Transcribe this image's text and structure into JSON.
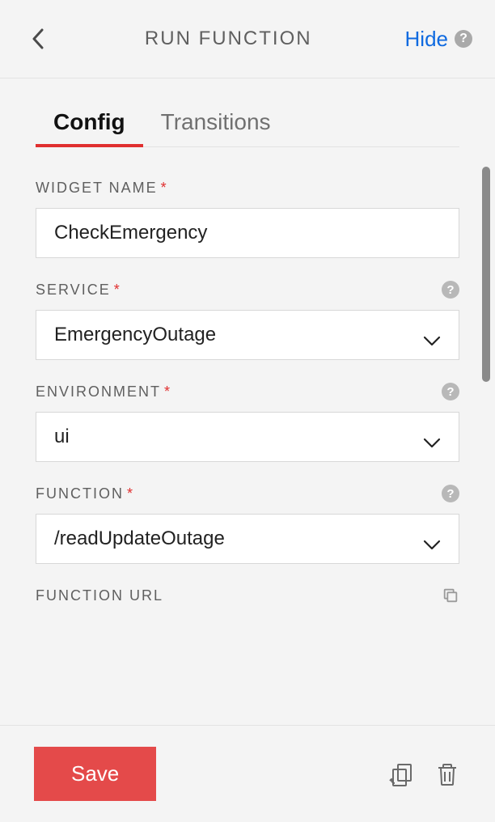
{
  "header": {
    "title": "RUN FUNCTION",
    "hide_label": "Hide"
  },
  "tabs": {
    "config": "Config",
    "transitions": "Transitions"
  },
  "form": {
    "widget_name": {
      "label": "WIDGET NAME",
      "value": "CheckEmergency"
    },
    "service": {
      "label": "SERVICE",
      "value": "EmergencyOutage"
    },
    "environment": {
      "label": "ENVIRONMENT",
      "value": "ui"
    },
    "function": {
      "label": "FUNCTION",
      "value": "/readUpdateOutage"
    },
    "function_url": {
      "label": "FUNCTION URL"
    }
  },
  "footer": {
    "save": "Save"
  }
}
